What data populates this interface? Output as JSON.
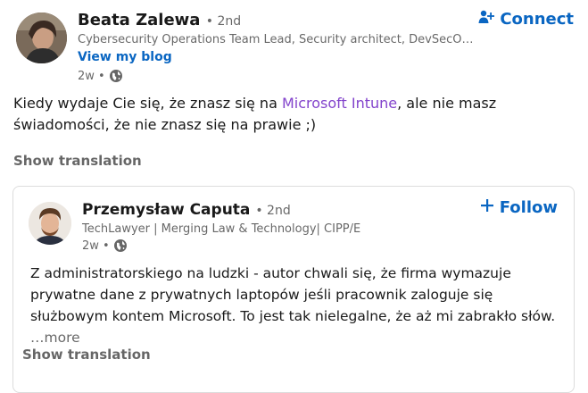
{
  "post": {
    "author": {
      "name": "Beata Zalewa",
      "degree": "• 2nd",
      "headline": "Cybersecurity Operations Team Lead, Security architect, DevSecOp…",
      "blog_link": "View my blog",
      "time": "2w •",
      "visibility_icon": "globe-icon"
    },
    "connect_label": "Connect",
    "text_before": "Kiedy wydaje Cie się, że znasz się na ",
    "mention": "Microsoft Intune",
    "text_after": ", ale nie masz świadomości, że nie znasz się na prawie ;)",
    "show_translation": "Show translation"
  },
  "reshared": {
    "author": {
      "name": "Przemysław Caputa",
      "degree": "• 2nd",
      "headline": "TechLawyer | Merging Law & Technology| CIPP/E",
      "time": "2w •",
      "visibility_icon": "globe-icon"
    },
    "follow_label": "Follow",
    "text": "Z administratorskiego na ludzki - autor chwali się, że firma wymazuje prywatne dane z prywatnych laptopów jeśli pracownik zaloguje się służbowym kontem Microsoft. To jest tak nielegalne, że aż mi zabrakło słów.",
    "more": "…more",
    "show_translation": "Show translation"
  },
  "colors": {
    "link_blue": "#0a66c2",
    "mention_purple": "#8344cc",
    "secondary_text": "#666666"
  }
}
